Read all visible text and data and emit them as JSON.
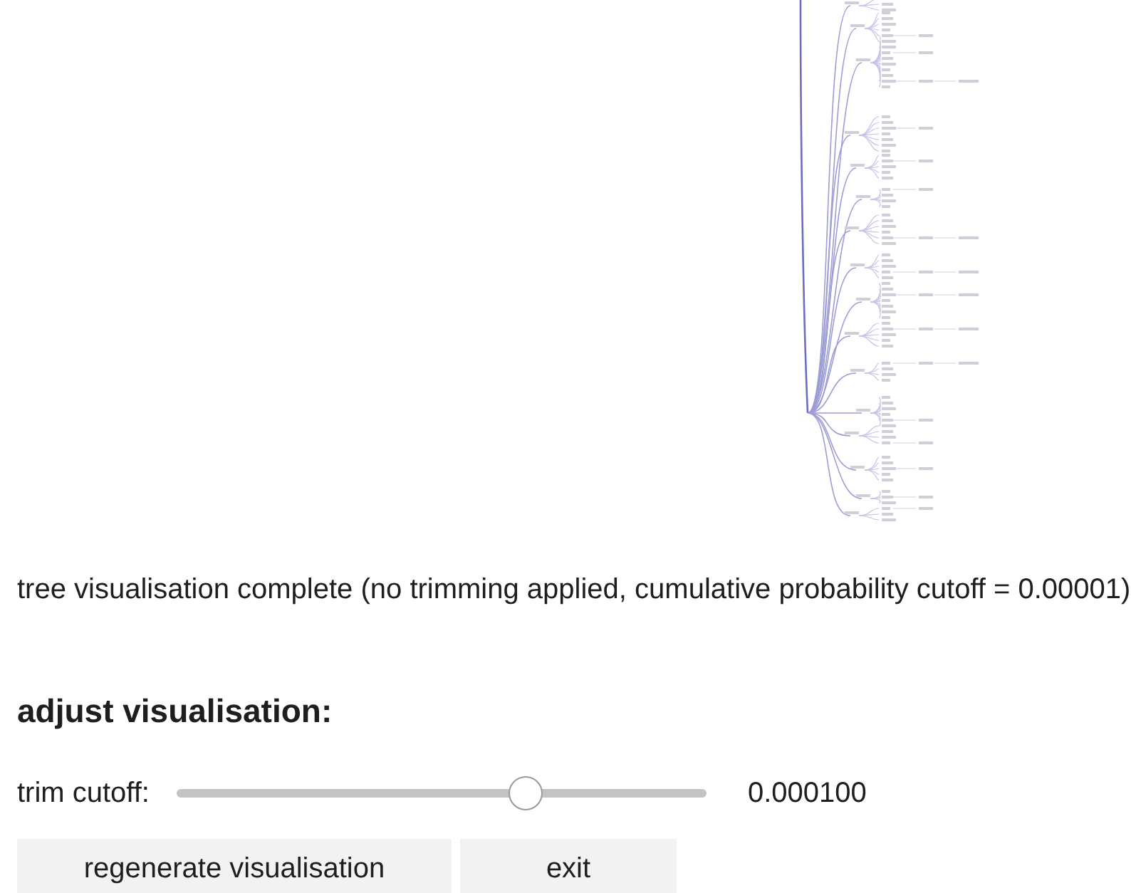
{
  "status_message": "tree visualisation complete (no trimming applied, cumulative probability cutoff = 0.00001)",
  "adjust_section": {
    "heading": "adjust visualisation:",
    "slider": {
      "label": "trim cutoff:",
      "level": 0.67,
      "reading": "0.000100"
    },
    "buttons": [
      {
        "label": "regenerate visualisation"
      },
      {
        "label": "exit"
      }
    ]
  }
}
